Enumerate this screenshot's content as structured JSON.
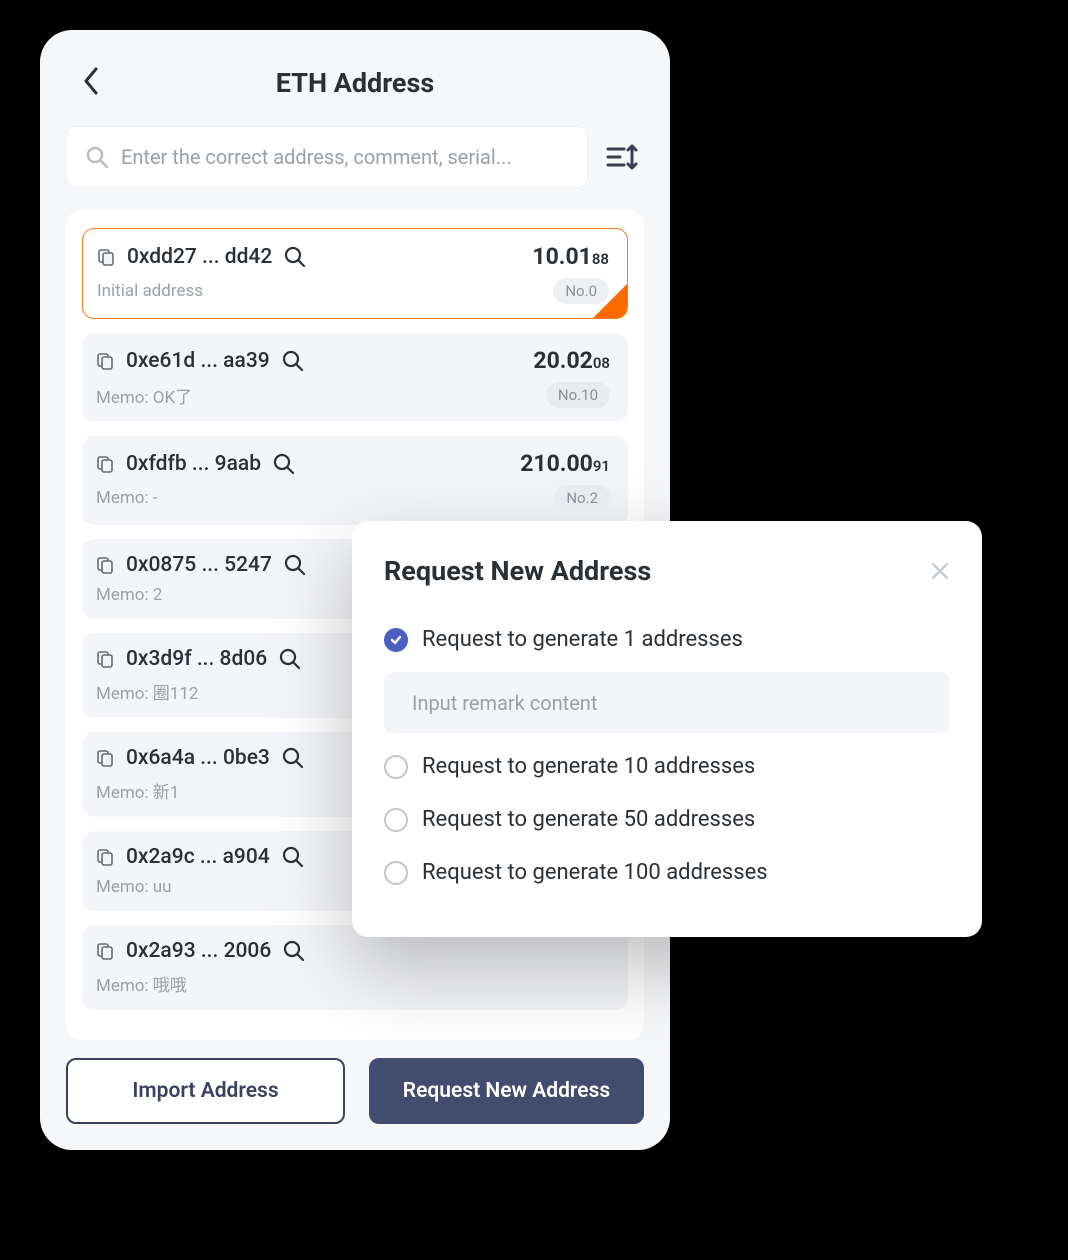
{
  "header": {
    "title": "ETH Address"
  },
  "search": {
    "placeholder": "Enter the correct address, comment, serial..."
  },
  "addresses": [
    {
      "addr": "0xdd27 ... dd42",
      "amount": "10.01",
      "amount_dec": "88",
      "memo": "Initial address",
      "badge": "No.0",
      "selected": true
    },
    {
      "addr": "0xe61d ... aa39",
      "amount": "20.02",
      "amount_dec": "08",
      "memo": "Memo: OK了",
      "badge": "No.10",
      "selected": false
    },
    {
      "addr": "0xfdfb ... 9aab",
      "amount": "210.00",
      "amount_dec": "91",
      "memo": "Memo: -",
      "badge": "No.2",
      "selected": false
    },
    {
      "addr": "0x0875 ... 5247",
      "amount": "",
      "amount_dec": "",
      "memo": "Memo: 2",
      "badge": "",
      "selected": false
    },
    {
      "addr": "0x3d9f ... 8d06",
      "amount": "",
      "amount_dec": "",
      "memo": "Memo: 圈112",
      "badge": "",
      "selected": false
    },
    {
      "addr": "0x6a4a ... 0be3",
      "amount": "",
      "amount_dec": "",
      "memo": "Memo: 新1",
      "badge": "",
      "selected": false
    },
    {
      "addr": "0x2a9c ... a904",
      "amount": "",
      "amount_dec": "",
      "memo": "Memo: uu",
      "badge": "",
      "selected": false
    },
    {
      "addr": "0x2a93 ... 2006",
      "amount": "",
      "amount_dec": "",
      "memo": "Memo: 哦哦",
      "badge": "",
      "selected": false
    }
  ],
  "buttons": {
    "import": "Import Address",
    "request": "Request New Address"
  },
  "dialog": {
    "title": "Request New Address",
    "remark_placeholder": "Input remark content",
    "options": [
      {
        "label": "Request to generate 1 addresses",
        "checked": true
      },
      {
        "label": "Request to generate 10 addresses",
        "checked": false
      },
      {
        "label": "Request to generate 50 addresses",
        "checked": false
      },
      {
        "label": "Request to generate 100 addresses",
        "checked": false
      }
    ]
  }
}
